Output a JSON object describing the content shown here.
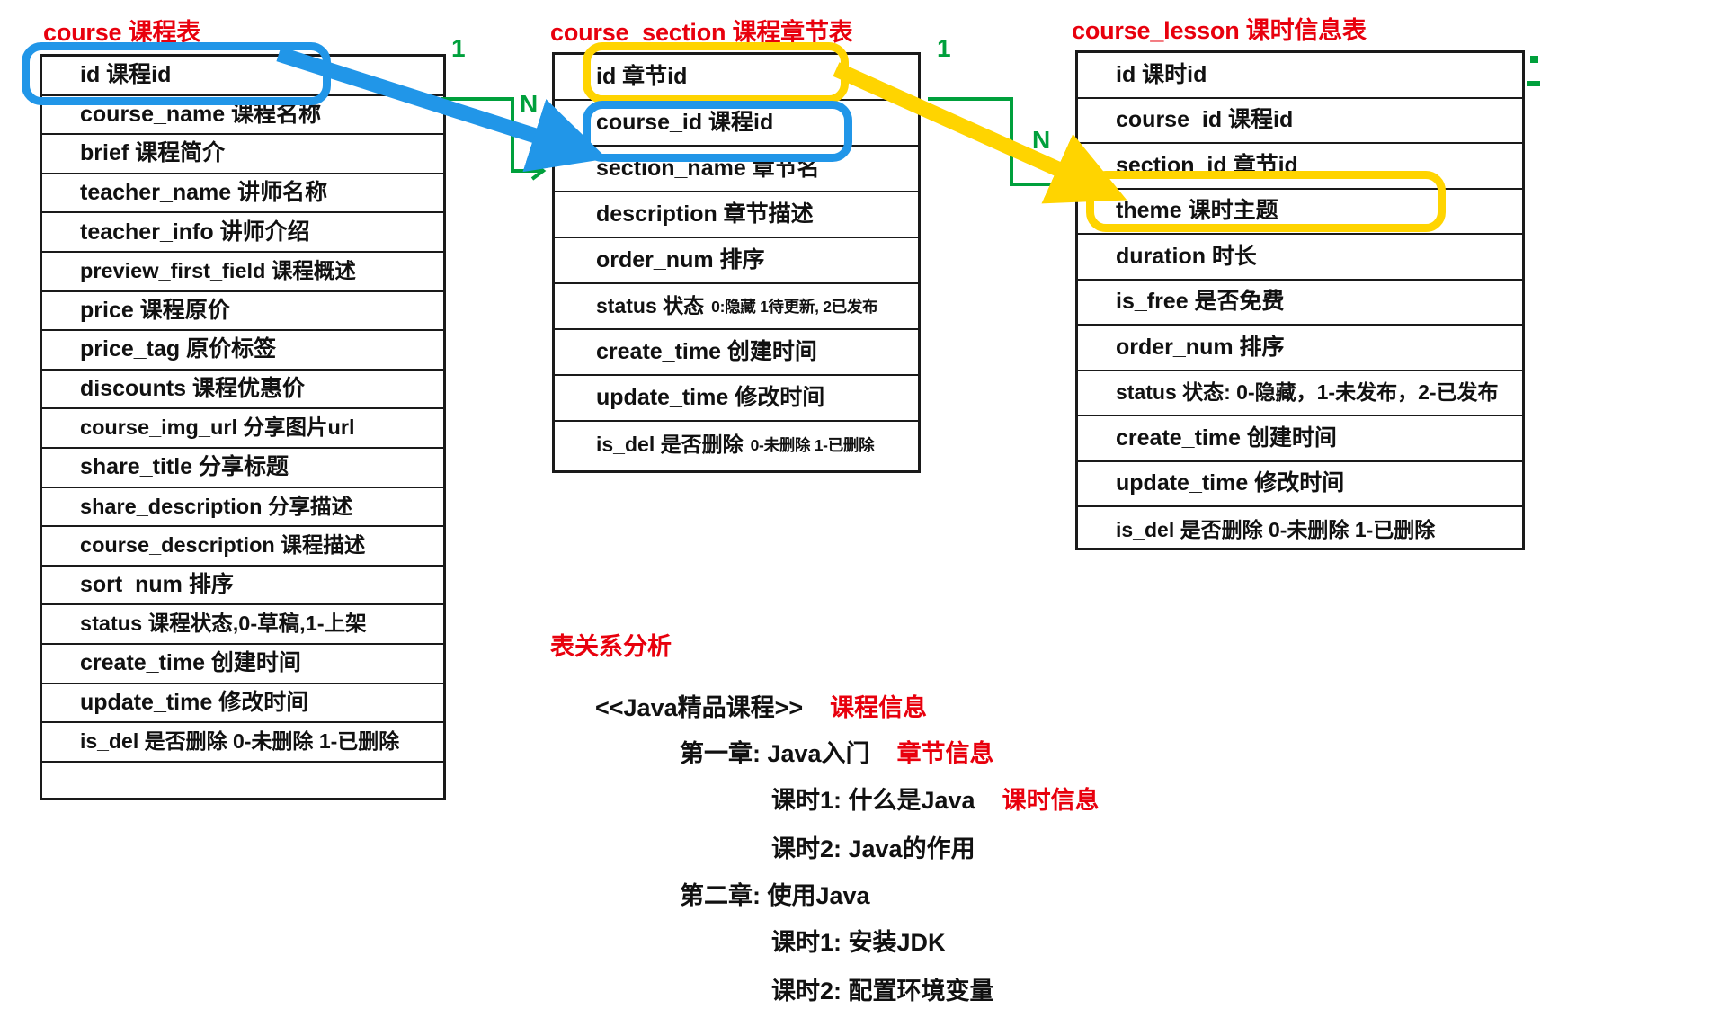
{
  "tables": [
    {
      "title": "course 课程表",
      "name": "course",
      "rows": [
        {
          "text": "id   课程id"
        },
        {
          "text": "course_name  课程名称"
        },
        {
          "text": "brief   课程简介"
        },
        {
          "text": "teacher_name  讲师名称"
        },
        {
          "text": "teacher_info   讲师介绍"
        },
        {
          "text": "preview_first_field 课程概述"
        },
        {
          "text": "price 课程原价"
        },
        {
          "text": "price_tag   原价标签"
        },
        {
          "text": "discounts 课程优惠价"
        },
        {
          "text": "course_img_url  分享图片url"
        },
        {
          "text": "share_title   分享标题"
        },
        {
          "text": "share_description  分享描述"
        },
        {
          "text": "course_description  课程描述"
        },
        {
          "text": "sort_num   排序"
        },
        {
          "text": "status 课程状态,0-草稿,1-上架"
        },
        {
          "text": "create_time 创建时间"
        },
        {
          "text": "update_time 修改时间"
        },
        {
          "text": "is_del 是否删除 0-未删除 1-已删除"
        },
        {
          "text": ""
        }
      ]
    },
    {
      "title": "course_section 课程章节表",
      "name": "course_section",
      "rows": [
        {
          "text": "id   章节id"
        },
        {
          "text": "course_id   课程id"
        },
        {
          "text": "section_name  章节名"
        },
        {
          "text": "description  章节描述"
        },
        {
          "text": "order_num  排序"
        },
        {
          "text": "status 状态",
          "sub": "0:隐藏 1待更新, 2已发布"
        },
        {
          "text": "create_time 创建时间"
        },
        {
          "text": "update_time 修改时间"
        },
        {
          "text": "is_del 是否删除",
          "sub": "0-未删除 1-已删除"
        }
      ]
    },
    {
      "title": "course_lesson 课时信息表",
      "name": "course_lesson",
      "rows": [
        {
          "text": "id   课时id"
        },
        {
          "text": "course_id 课程id"
        },
        {
          "text": "section_id 章节id"
        },
        {
          "text": "theme  课时主题"
        },
        {
          "text": "duration  时长"
        },
        {
          "text": "is_free   是否免费"
        },
        {
          "text": "order_num 排序"
        },
        {
          "text": "status  状态: 0-隐藏，1-未发布，2-已发布"
        },
        {
          "text": "create_time 创建时间"
        },
        {
          "text": "update_time 修改时间"
        },
        {
          "text": "is_del 是否删除 0-未删除 1-已删除"
        }
      ]
    }
  ],
  "relationships": [
    {
      "name": "course-to-section",
      "one_label": "1",
      "many_label": "N",
      "color": "#00a03c"
    },
    {
      "name": "section-to-lesson",
      "one_label": "1",
      "many_label": "N",
      "color": "#00a03c"
    }
  ],
  "highlights": {
    "blue_color": "#2196e8",
    "yellow_color": "#ffd400"
  },
  "analysis": {
    "title": "表关系分析",
    "lines": [
      {
        "text": "<<Java精品课程>>",
        "tag": "课程信息",
        "indent": 0
      },
      {
        "text": "第一章: Java入门",
        "tag": "章节信息",
        "indent": 1
      },
      {
        "text": "课时1: 什么是Java",
        "tag": "课时信息",
        "indent": 2
      },
      {
        "text": "课时2: Java的作用",
        "tag": "",
        "indent": 2
      },
      {
        "text": "第二章: 使用Java",
        "tag": "",
        "indent": 1
      },
      {
        "text": "课时1: 安装JDK",
        "tag": "",
        "indent": 2
      },
      {
        "text": "课时2: 配置环境变量",
        "tag": "",
        "indent": 2
      }
    ]
  }
}
